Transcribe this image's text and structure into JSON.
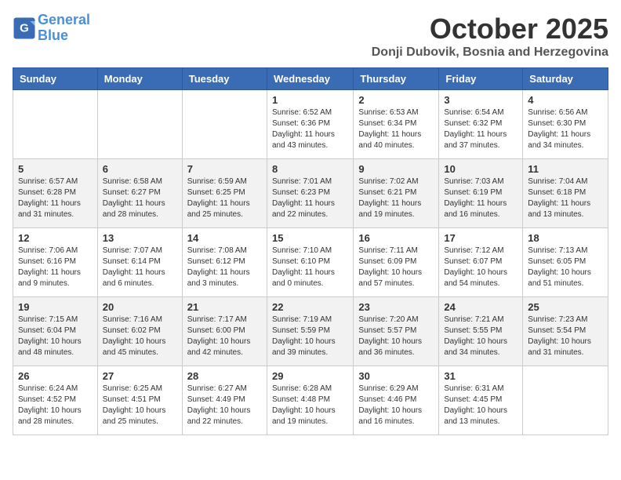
{
  "header": {
    "logo_line1": "General",
    "logo_line2": "Blue",
    "month_title": "October 2025",
    "location": "Donji Dubovik, Bosnia and Herzegovina"
  },
  "days_of_week": [
    "Sunday",
    "Monday",
    "Tuesday",
    "Wednesday",
    "Thursday",
    "Friday",
    "Saturday"
  ],
  "weeks": [
    [
      {
        "day": "",
        "info": ""
      },
      {
        "day": "",
        "info": ""
      },
      {
        "day": "",
        "info": ""
      },
      {
        "day": "1",
        "info": "Sunrise: 6:52 AM\nSunset: 6:36 PM\nDaylight: 11 hours\nand 43 minutes."
      },
      {
        "day": "2",
        "info": "Sunrise: 6:53 AM\nSunset: 6:34 PM\nDaylight: 11 hours\nand 40 minutes."
      },
      {
        "day": "3",
        "info": "Sunrise: 6:54 AM\nSunset: 6:32 PM\nDaylight: 11 hours\nand 37 minutes."
      },
      {
        "day": "4",
        "info": "Sunrise: 6:56 AM\nSunset: 6:30 PM\nDaylight: 11 hours\nand 34 minutes."
      }
    ],
    [
      {
        "day": "5",
        "info": "Sunrise: 6:57 AM\nSunset: 6:28 PM\nDaylight: 11 hours\nand 31 minutes."
      },
      {
        "day": "6",
        "info": "Sunrise: 6:58 AM\nSunset: 6:27 PM\nDaylight: 11 hours\nand 28 minutes."
      },
      {
        "day": "7",
        "info": "Sunrise: 6:59 AM\nSunset: 6:25 PM\nDaylight: 11 hours\nand 25 minutes."
      },
      {
        "day": "8",
        "info": "Sunrise: 7:01 AM\nSunset: 6:23 PM\nDaylight: 11 hours\nand 22 minutes."
      },
      {
        "day": "9",
        "info": "Sunrise: 7:02 AM\nSunset: 6:21 PM\nDaylight: 11 hours\nand 19 minutes."
      },
      {
        "day": "10",
        "info": "Sunrise: 7:03 AM\nSunset: 6:19 PM\nDaylight: 11 hours\nand 16 minutes."
      },
      {
        "day": "11",
        "info": "Sunrise: 7:04 AM\nSunset: 6:18 PM\nDaylight: 11 hours\nand 13 minutes."
      }
    ],
    [
      {
        "day": "12",
        "info": "Sunrise: 7:06 AM\nSunset: 6:16 PM\nDaylight: 11 hours\nand 9 minutes."
      },
      {
        "day": "13",
        "info": "Sunrise: 7:07 AM\nSunset: 6:14 PM\nDaylight: 11 hours\nand 6 minutes."
      },
      {
        "day": "14",
        "info": "Sunrise: 7:08 AM\nSunset: 6:12 PM\nDaylight: 11 hours\nand 3 minutes."
      },
      {
        "day": "15",
        "info": "Sunrise: 7:10 AM\nSunset: 6:10 PM\nDaylight: 11 hours\nand 0 minutes."
      },
      {
        "day": "16",
        "info": "Sunrise: 7:11 AM\nSunset: 6:09 PM\nDaylight: 10 hours\nand 57 minutes."
      },
      {
        "day": "17",
        "info": "Sunrise: 7:12 AM\nSunset: 6:07 PM\nDaylight: 10 hours\nand 54 minutes."
      },
      {
        "day": "18",
        "info": "Sunrise: 7:13 AM\nSunset: 6:05 PM\nDaylight: 10 hours\nand 51 minutes."
      }
    ],
    [
      {
        "day": "19",
        "info": "Sunrise: 7:15 AM\nSunset: 6:04 PM\nDaylight: 10 hours\nand 48 minutes."
      },
      {
        "day": "20",
        "info": "Sunrise: 7:16 AM\nSunset: 6:02 PM\nDaylight: 10 hours\nand 45 minutes."
      },
      {
        "day": "21",
        "info": "Sunrise: 7:17 AM\nSunset: 6:00 PM\nDaylight: 10 hours\nand 42 minutes."
      },
      {
        "day": "22",
        "info": "Sunrise: 7:19 AM\nSunset: 5:59 PM\nDaylight: 10 hours\nand 39 minutes."
      },
      {
        "day": "23",
        "info": "Sunrise: 7:20 AM\nSunset: 5:57 PM\nDaylight: 10 hours\nand 36 minutes."
      },
      {
        "day": "24",
        "info": "Sunrise: 7:21 AM\nSunset: 5:55 PM\nDaylight: 10 hours\nand 34 minutes."
      },
      {
        "day": "25",
        "info": "Sunrise: 7:23 AM\nSunset: 5:54 PM\nDaylight: 10 hours\nand 31 minutes."
      }
    ],
    [
      {
        "day": "26",
        "info": "Sunrise: 6:24 AM\nSunset: 4:52 PM\nDaylight: 10 hours\nand 28 minutes."
      },
      {
        "day": "27",
        "info": "Sunrise: 6:25 AM\nSunset: 4:51 PM\nDaylight: 10 hours\nand 25 minutes."
      },
      {
        "day": "28",
        "info": "Sunrise: 6:27 AM\nSunset: 4:49 PM\nDaylight: 10 hours\nand 22 minutes."
      },
      {
        "day": "29",
        "info": "Sunrise: 6:28 AM\nSunset: 4:48 PM\nDaylight: 10 hours\nand 19 minutes."
      },
      {
        "day": "30",
        "info": "Sunrise: 6:29 AM\nSunset: 4:46 PM\nDaylight: 10 hours\nand 16 minutes."
      },
      {
        "day": "31",
        "info": "Sunrise: 6:31 AM\nSunset: 4:45 PM\nDaylight: 10 hours\nand 13 minutes."
      },
      {
        "day": "",
        "info": ""
      }
    ]
  ]
}
